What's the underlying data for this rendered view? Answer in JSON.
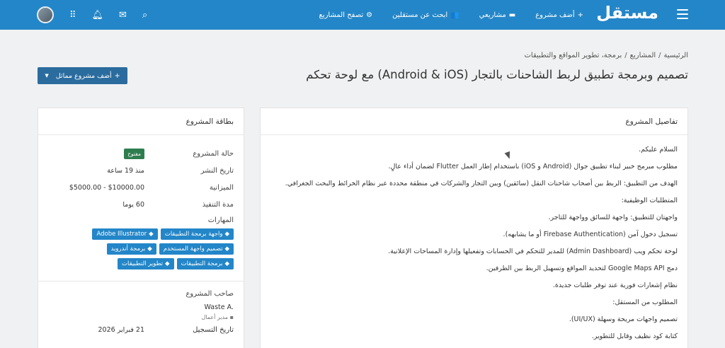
{
  "navbar": {
    "logo": "مستقل",
    "links": [
      {
        "label": "أضف مشروع",
        "icon": "+"
      },
      {
        "label": "مشاريعي",
        "icon": "▬"
      },
      {
        "label": "ابحث عن مستقلين",
        "icon": "👥"
      },
      {
        "label": "تصفح المشاريع",
        "icon": "⚙"
      }
    ]
  },
  "breadcrumb": [
    "الرئيسية",
    "المشاريع",
    "برمجة، تطوير المواقع والتطبيقات"
  ],
  "breadcrumb_sep": "/",
  "page": {
    "title": "تصميم وبرمجة تطبيق لربط الشاحنات بالتجار (Android & iOS) مع لوحة تحكم",
    "add_similar_label": "أضف مشروع مماثل"
  },
  "details": {
    "heading": "تفاصيل المشروع",
    "paragraphs": [
      "السلام عليكم.",
      "مطلوب مبرمج خبير لبناء تطبيق جوال (Android و iOS) باستخدام إطار العمل Flutter لضمان أداء عالٍ.",
      "الهدف من التطبيق: الربط بين أصحاب شاحنات النقل (سائقين) وبين التجار والشركات في منطقة محددة عبر نظام الخرائط والبحث الجغرافي.",
      "المتطلبات الوظيفية:",
      "واجهتان للتطبيق: واجهة للسائق وواجهة للتاجر.",
      "تسجيل دخول آمن (Firebase Authentication أو ما يشابهه).",
      "لوحة تحكم ويب (Admin Dashboard) للمدير للتحكم في الحسابات وتفعيلها وإدارة المساحات الإعلانية.",
      "دمج Google Maps API لتحديد المواقع وتسهيل الربط بين الطرفين.",
      "نظام إشعارات فورية عند توفر طلبات جديدة.",
      "المطلوب من المستقل:",
      "تصميم واجهات مريحة وسهلة (UI/UX).",
      "كتابة كود نظيف وقابل للتطوير."
    ]
  },
  "card": {
    "heading": "بطاقة المشروع",
    "status_label": "حالة المشروع",
    "status_value": "مفتوح",
    "posted_label": "تاريخ النشر",
    "posted_value": "منذ 19 ساعة",
    "budget_label": "الميزانية",
    "budget_value": "$5000.00 - $10000.00",
    "duration_label": "مدة التنفيذ",
    "duration_value": "60 يوما",
    "skills_label": "المهارات",
    "skills": [
      "واجهة برمجة التطبيقات",
      "Adobe Illustrator",
      "تصميم واجهة المستخدم",
      "برمجة أندرويد",
      "برمجة التطبيقات",
      "تطوير التطبيقات"
    ],
    "owner_label": "صاحب المشروع",
    "owner_name": "Waste A.",
    "owner_role": "مدير أعمال",
    "reg_label": "تاريخ التسجيل",
    "reg_value": "21 فبراير 2026"
  },
  "colors": {
    "brand": "#2386c8",
    "button_dark": "#2b6c9e",
    "open_badge": "#2e7d4f"
  }
}
